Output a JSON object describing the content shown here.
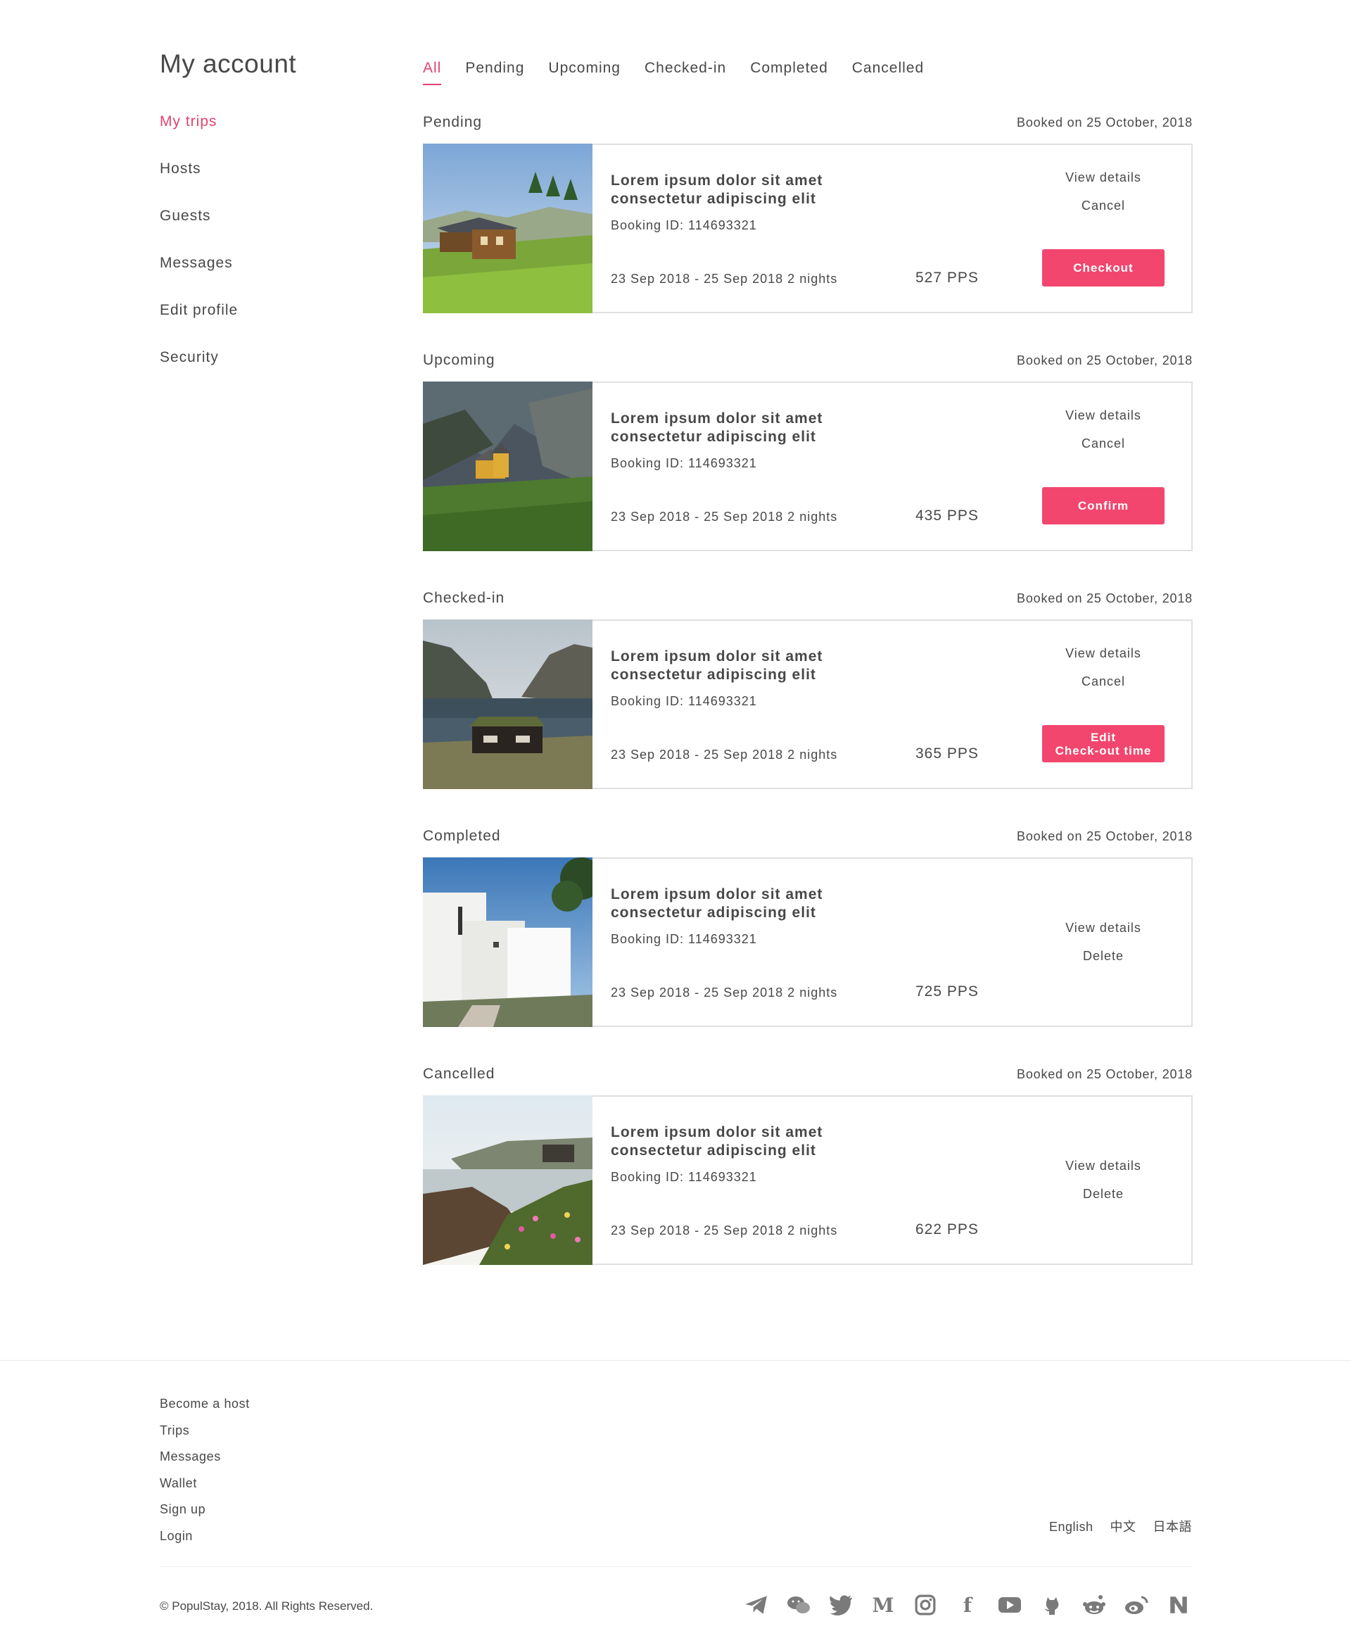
{
  "page": {
    "title": "My account"
  },
  "sidebar": {
    "items": [
      {
        "label": "My trips",
        "active": true
      },
      {
        "label": "Hosts"
      },
      {
        "label": "Guests"
      },
      {
        "label": "Messages"
      },
      {
        "label": "Edit profile"
      },
      {
        "label": "Security"
      }
    ]
  },
  "tabs": [
    {
      "label": "All",
      "active": true
    },
    {
      "label": "Pending"
    },
    {
      "label": "Upcoming"
    },
    {
      "label": "Checked-in"
    },
    {
      "label": "Completed"
    },
    {
      "label": "Cancelled"
    }
  ],
  "trips": [
    {
      "status": "Pending",
      "booked_on": "Booked on 25 October, 2018",
      "title_line1": "Lorem ipsum dolor sit amet",
      "title_line2": "consectetur adipiscing elit",
      "booking_id": "Booking ID: 114693321",
      "dates": "23 Sep 2018 - 25 Sep 2018  2 nights",
      "price": "527 PPS",
      "actions": [
        "View details",
        "Cancel"
      ],
      "primary": "Checkout"
    },
    {
      "status": "Upcoming",
      "booked_on": "Booked on 25 October, 2018",
      "title_line1": "Lorem ipsum dolor sit amet",
      "title_line2": "consectetur adipiscing elit",
      "booking_id": "Booking ID: 114693321",
      "dates": "23 Sep 2018 - 25 Sep 2018  2 nights",
      "price": "435 PPS",
      "actions": [
        "View details",
        "Cancel"
      ],
      "primary": "Confirm"
    },
    {
      "status": "Checked-in",
      "booked_on": "Booked on 25 October, 2018",
      "title_line1": "Lorem ipsum dolor sit amet",
      "title_line2": "consectetur adipiscing elit",
      "booking_id": "Booking ID: 114693321",
      "dates": "23 Sep 2018 - 25 Sep 2018  2 nights",
      "price": "365 PPS",
      "actions": [
        "View details",
        "Cancel"
      ],
      "primary_line1": "Edit",
      "primary_line2": "Check-out time"
    },
    {
      "status": "Completed",
      "booked_on": "Booked on 25 October, 2018",
      "title_line1": "Lorem ipsum dolor sit amet",
      "title_line2": "consectetur adipiscing elit",
      "booking_id": "Booking ID: 114693321",
      "dates": "23 Sep 2018 - 25 Sep 2018  2 nights",
      "price": "725 PPS",
      "actions": [
        "View details",
        "Delete"
      ]
    },
    {
      "status": "Cancelled",
      "booked_on": "Booked on 25 October, 2018",
      "title_line1": "Lorem ipsum dolor sit amet",
      "title_line2": "consectetur adipiscing elit",
      "booking_id": "Booking ID: 114693321",
      "dates": "23 Sep 2018 - 25 Sep 2018  2 nights",
      "price": "622 PPS",
      "actions": [
        "View details",
        "Delete"
      ]
    }
  ],
  "footer": {
    "links": [
      "Become a host",
      "Trips",
      "Messages",
      "Wallet",
      "Sign up",
      "Login"
    ],
    "languages": [
      "English",
      "中文",
      "日本語"
    ],
    "copyright": "© PopulStay, 2018. All Rights Reserved.",
    "socials": [
      "telegram-icon",
      "wechat-icon",
      "twitter-icon",
      "medium-icon",
      "instagram-icon",
      "facebook-icon",
      "youtube-icon",
      "github-icon",
      "reddit-icon",
      "weibo-icon",
      "neo-icon"
    ],
    "medium_glyph": "M",
    "facebook_glyph": "f"
  },
  "colors": {
    "accent": "#e2436f",
    "button": "#f2466e",
    "text": "#484848",
    "border": "#e0e0e0"
  }
}
